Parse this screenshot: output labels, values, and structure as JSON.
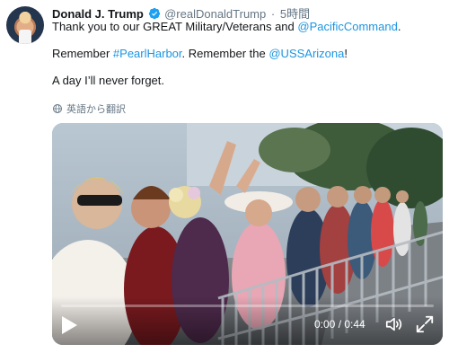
{
  "tweet": {
    "display_name": "Donald J. Trump",
    "handle": "@realDonaldTrump",
    "separator": "·",
    "time": "5時間",
    "line1_prefix": "Thank you to our GREAT Military/Veterans and ",
    "line1_link": "@PacificCommand",
    "line1_suffix": ".",
    "line2_prefix": "Remember ",
    "line2_hashtag": "#PearlHarbor",
    "line2_middle": ". Remember the ",
    "line2_link": "@USSArizona",
    "line2_suffix": "!",
    "line3": "A day I’ll never forget.",
    "translate_label": "英語から翻訳"
  },
  "video": {
    "time_display": "0:00 / 0:44",
    "progress": 0
  },
  "colors": {
    "link": "#1b95e0",
    "verified": "#1da1f2",
    "muted_text": "#657786"
  },
  "icons": [
    "avatar",
    "verified-badge-icon",
    "globe-icon",
    "play-icon",
    "volume-icon",
    "fullscreen-icon"
  ]
}
